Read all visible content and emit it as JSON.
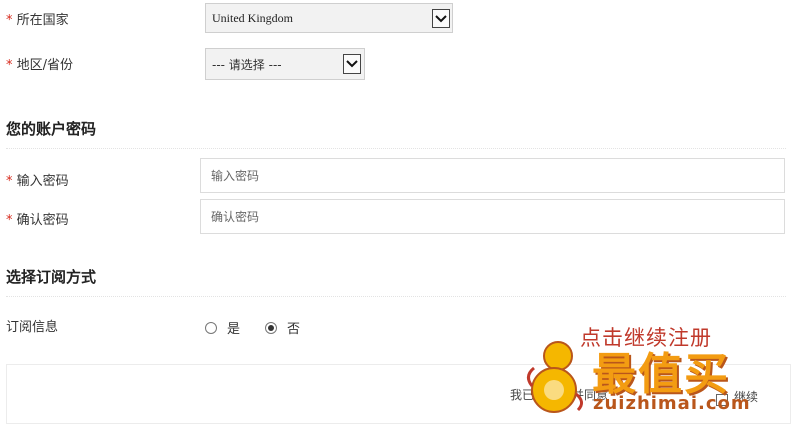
{
  "form": {
    "country": {
      "required_mark": "*",
      "label": "所在国家",
      "value": "United Kingdom"
    },
    "region": {
      "required_mark": "*",
      "label": "地区/省份",
      "value": "--- 请选择 ---"
    },
    "password_section": {
      "title": "您的账户密码"
    },
    "password": {
      "required_mark": "*",
      "label": "输入密码",
      "placeholder": "输入密码"
    },
    "password_confirm": {
      "required_mark": "*",
      "label": "确认密码",
      "placeholder": "确认密码"
    },
    "subscribe_section": {
      "title": "选择订阅方式"
    },
    "subscribe": {
      "label": "订阅信息",
      "options": [
        {
          "label": "是",
          "selected": false
        },
        {
          "label": "否",
          "selected": true
        }
      ]
    },
    "bottom_panel": {
      "text_left": "我已",
      "text_mid": "并同意",
      "text_right": "继续"
    }
  },
  "overlay": {
    "annotation": "点击继续注册",
    "watermark_cn": "最值买",
    "watermark_url": "zuizhimai.com"
  },
  "colors": {
    "required": "#d7281b",
    "annotation": "#c0392b",
    "watermark": "#f39c12"
  }
}
